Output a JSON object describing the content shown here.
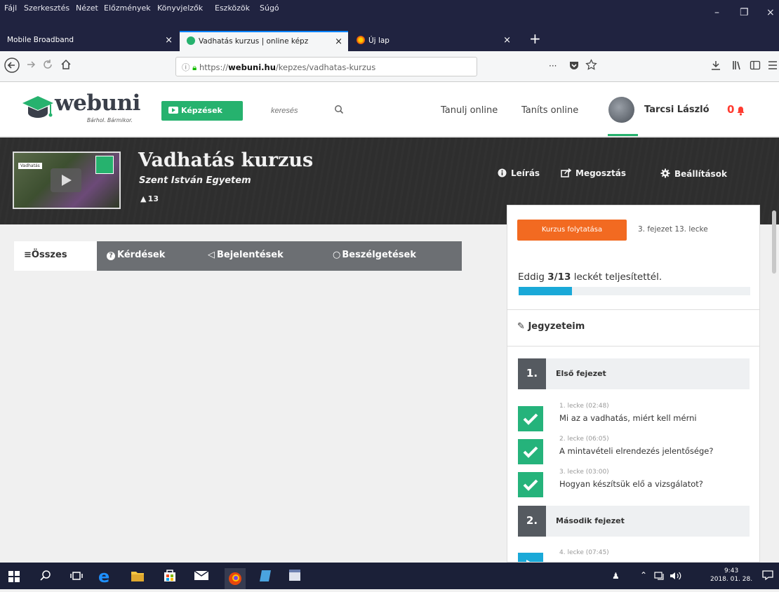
{
  "menubar": {
    "items": [
      "Fájl",
      "Szerkesztés",
      "Nézet",
      "Előzmények",
      "Könyvjelzők",
      "Eszközök",
      "Súgó"
    ],
    "minimize": "–",
    "maximize": "❐",
    "close": "×"
  },
  "tabs": [
    {
      "title": "Mobile Broadband",
      "close": "×"
    },
    {
      "title": "Vadhatás kurzus | online képz",
      "close": "×"
    },
    {
      "title": "Új lap",
      "close": "×"
    }
  ],
  "new_tab": "+",
  "navbar": {
    "url_prefix": "https://",
    "url_domain": "webuni.hu",
    "url_path": "/kepzes/vadhatas-kurzus",
    "more": "···"
  },
  "site": {
    "logo": "webuni",
    "logo_tag": "Bárhol. Bármikor.",
    "kepzesek_label": "Képzések",
    "search_placeholder": "keresés",
    "nav_learn": "Tanulj online",
    "nav_teach": "Taníts online",
    "user_name": "Tarcsi László",
    "notification_count": "0"
  },
  "course": {
    "thumb_label": "Vadhatás",
    "title": "Vadhatás kurzus",
    "university": "Szent István Egyetem",
    "students": "13",
    "actions": [
      "Leírás",
      "Megosztás",
      "Beállítások"
    ]
  },
  "filters": [
    "Összes",
    "Kérdések",
    "Bejelentések",
    "Beszélgetések"
  ],
  "sidebar": {
    "continue_label": "Kurzus folytatása",
    "continue_position": "3. fejezet 13. lecke",
    "progress_prefix": "Eddig ",
    "progress_value": "3/13",
    "progress_suffix": " leckét teljesítettél.",
    "progress_fraction": 0.23,
    "notes_label": "Jegyzeteim",
    "chapters": [
      {
        "num": "1.",
        "title": "Első fejezet"
      },
      {
        "num": "2.",
        "title": "Második fejezet"
      }
    ],
    "lessons": [
      {
        "meta": "1. lecke (02:48)",
        "title": "Mi az a vadhatás, miért kell mérni"
      },
      {
        "meta": "2. lecke (06:05)",
        "title": "A mintavételi elrendezés jelentősége?"
      },
      {
        "meta": "3. lecke (03:00)",
        "title": "Hogyan készítsük elő a vizsgálatot?"
      },
      {
        "meta": "4. lecke (07:45)",
        "title": ""
      }
    ]
  },
  "taskbar": {
    "time": "9:43",
    "date": "2018. 01. 28."
  },
  "colors": {
    "brand_green": "#26b26e",
    "accent_orange": "#f26a21",
    "progress_blue": "#1aa9d8",
    "check_green": "#25b37b",
    "notification_red": "#ff3b30"
  }
}
